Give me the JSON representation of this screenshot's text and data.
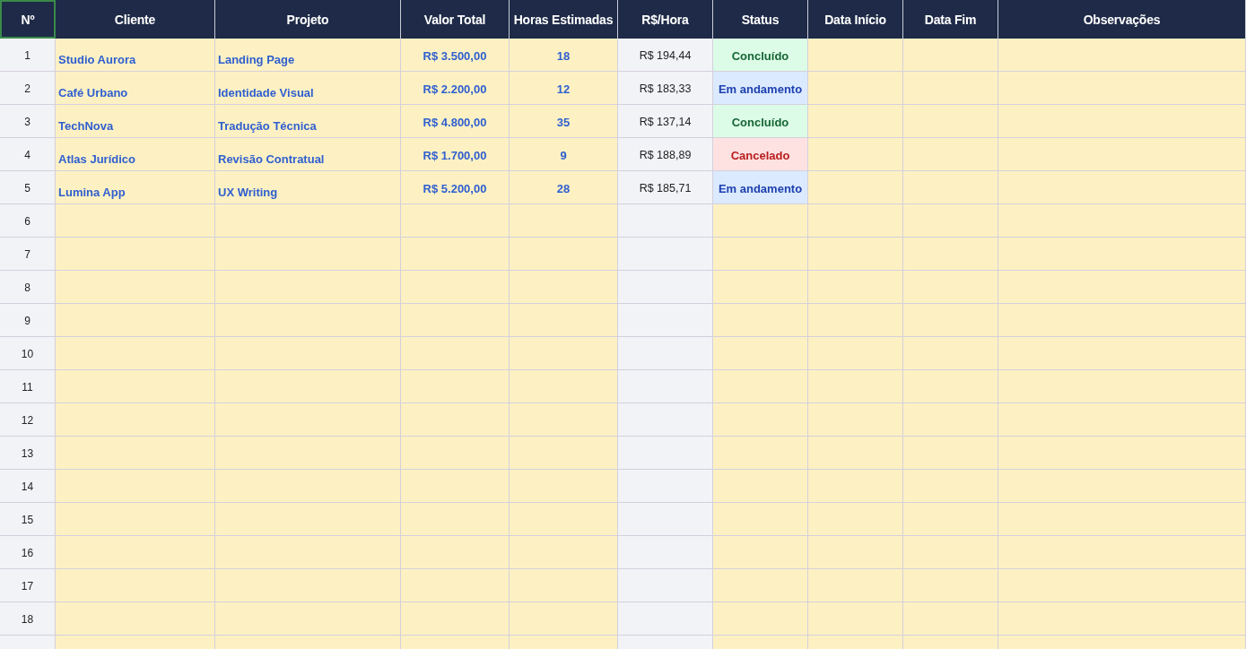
{
  "columns": [
    {
      "label": "Nº",
      "selected": true
    },
    {
      "label": "Cliente",
      "selected": false
    },
    {
      "label": "Projeto",
      "selected": false
    },
    {
      "label": "Valor Total",
      "selected": false
    },
    {
      "label": "Horas Estimadas",
      "selected": false
    },
    {
      "label": "R$/Hora",
      "selected": false
    },
    {
      "label": "Status",
      "selected": false
    },
    {
      "label": "Data Início",
      "selected": false
    },
    {
      "label": "Data Fim",
      "selected": false
    },
    {
      "label": "Observações",
      "selected": false
    }
  ],
  "rows": [
    {
      "number": "1",
      "client": "Studio Aurora",
      "project": "Landing Page",
      "total": "R$ 3.500,00",
      "hours": "18",
      "rate": "R$ 194,44",
      "status": {
        "label": "Concluído",
        "kind": "done"
      }
    },
    {
      "number": "2",
      "client": "Café Urbano",
      "project": "Identidade Visual",
      "total": "R$ 2.200,00",
      "hours": "12",
      "rate": "R$ 183,33",
      "status": {
        "label": "Em andamento",
        "kind": "progress"
      }
    },
    {
      "number": "3",
      "client": "TechNova",
      "project": "Tradução Técnica",
      "total": "R$ 4.800,00",
      "hours": "35",
      "rate": "R$ 137,14",
      "status": {
        "label": "Concluído",
        "kind": "done"
      }
    },
    {
      "number": "4",
      "client": "Atlas Jurídico",
      "project": "Revisão Contratual",
      "total": "R$ 1.700,00",
      "hours": "9",
      "rate": "R$ 188,89",
      "status": {
        "label": "Cancelado",
        "kind": "cancelled"
      }
    },
    {
      "number": "5",
      "client": "Lumina App",
      "project": "UX Writing",
      "total": "R$ 5.200,00",
      "hours": "28",
      "rate": "R$ 185,71",
      "status": {
        "label": "Em andamento",
        "kind": "progress"
      }
    },
    {
      "number": "6"
    },
    {
      "number": "7"
    },
    {
      "number": "8"
    },
    {
      "number": "9"
    },
    {
      "number": "10"
    },
    {
      "number": "11"
    },
    {
      "number": "12"
    },
    {
      "number": "13"
    },
    {
      "number": "14"
    },
    {
      "number": "15"
    },
    {
      "number": "16"
    },
    {
      "number": "17"
    },
    {
      "number": "18"
    }
  ]
}
